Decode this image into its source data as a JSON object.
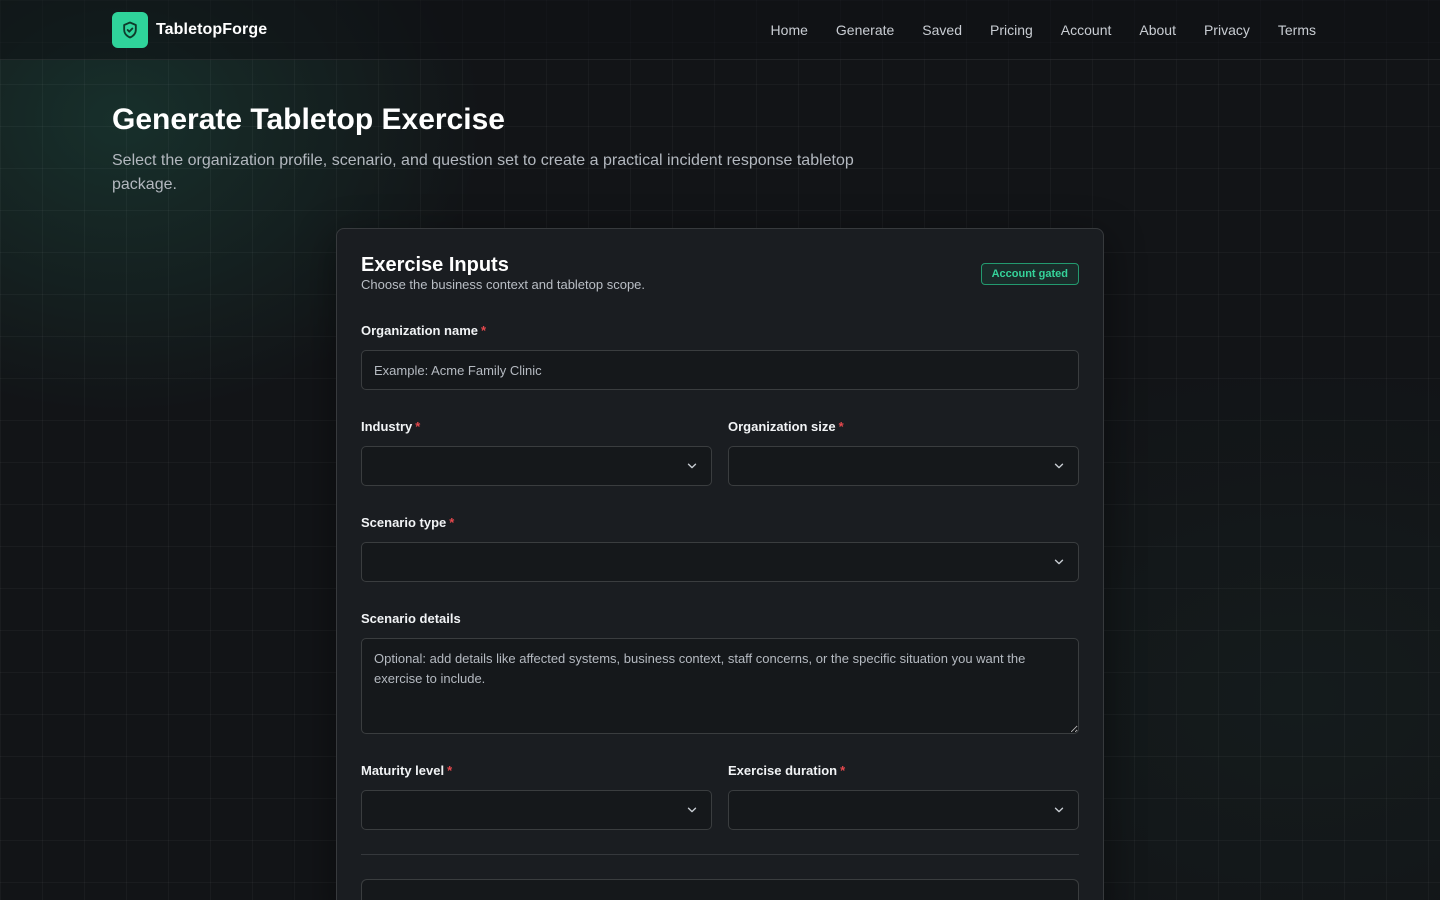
{
  "brand": {
    "name": "TabletopForge",
    "accent": "#2fd39a",
    "logo_icon": "shield-icon"
  },
  "nav": {
    "links": [
      "Home",
      "Generate",
      "Saved",
      "Pricing",
      "Account",
      "About",
      "Privacy",
      "Terms"
    ]
  },
  "header": {
    "title": "Generate Tabletop Exercise",
    "subtitle": "Select the organization profile, scenario, and question set to create a practical incident response tabletop package."
  },
  "card": {
    "title": "Exercise Inputs",
    "description": "Choose the business context and tabletop scope.",
    "badge": "Account gated",
    "required_marker": "*",
    "fields": {
      "organization_name": {
        "label": "Organization name",
        "placeholder": "Example: Acme Family Clinic",
        "value": ""
      },
      "industry": {
        "label": "Industry",
        "value": ""
      },
      "organization_size": {
        "label": "Organization size",
        "value": ""
      },
      "scenario_type": {
        "label": "Scenario type",
        "value": ""
      },
      "scenario_details": {
        "label": "Scenario details",
        "placeholder": "Optional: add details like affected systems, business context, staff concerns, or the specific situation you want the exercise to include.",
        "value": ""
      },
      "maturity_level": {
        "label": "Maturity level",
        "value": ""
      },
      "exercise_duration": {
        "label": "Exercise duration",
        "value": ""
      }
    }
  },
  "colors": {
    "required": "#e5484d",
    "badge_text": "#35d39a"
  }
}
